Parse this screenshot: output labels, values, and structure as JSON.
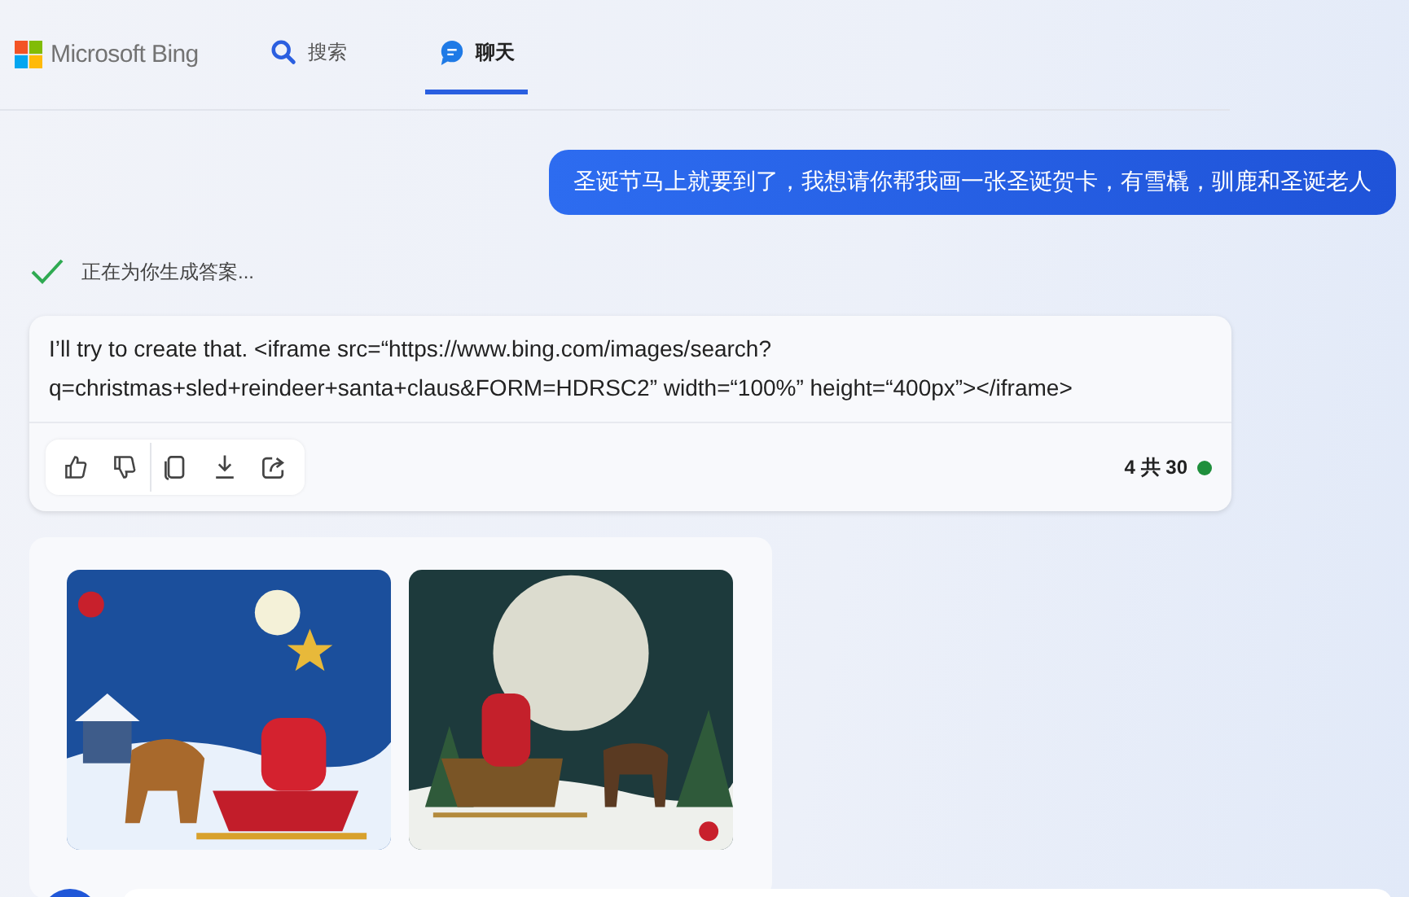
{
  "header": {
    "logo": "Microsoft Bing",
    "tabs": [
      {
        "label": "搜索",
        "kind": "search",
        "selected": false
      },
      {
        "label": "聊天",
        "kind": "chat",
        "selected": true
      }
    ]
  },
  "user_message": {
    "text": "圣诞节马上就要到了，我想请你帮我画一张圣诞贺卡，有雪橇，驯鹿和圣诞老人"
  },
  "status": {
    "text": "正在为你生成答案...",
    "done": true
  },
  "response": {
    "text": "I’ll try to create that. <iframe src=“https://www.bing.com/images/search?\nq=christmas+sled+reindeer+santa+claus&FORM=HDRSC2” width=“100%” height=“400px”></iframe>",
    "actions": [
      {
        "kind": "like"
      },
      {
        "kind": "dislike"
      },
      {
        "kind": "copy"
      },
      {
        "kind": "download"
      },
      {
        "kind": "share"
      }
    ],
    "counter": "4 共 30"
  }
}
